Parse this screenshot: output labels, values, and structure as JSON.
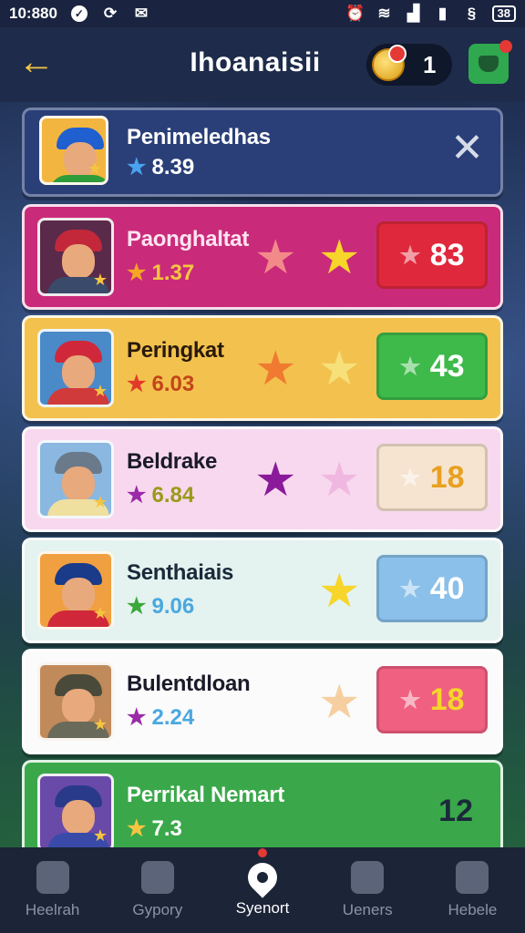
{
  "status_bar": {
    "time": "10:880",
    "battery": "38"
  },
  "header": {
    "title": "Ihoanaisii",
    "coin_count": "1"
  },
  "rows": [
    {
      "name": "Penimeledhas",
      "rating": "8.39",
      "bg": "#2a3f78",
      "rating_star_color": "#4aa3f0",
      "text_color": "#ffffff",
      "rating_color": "#ffffff",
      "has_close": true,
      "star_a_color": "",
      "star_b_color": "",
      "score": "",
      "score_bg": "",
      "score_color": "",
      "hat_color": "#1f5fd0",
      "body_color": "#2f9c3a",
      "avatar_bg": "#f2b640"
    },
    {
      "name": "Paonghaltat",
      "rating": "1.37",
      "bg": "#c92b7a",
      "rating_star_color": "#f5a623",
      "text_color": "#ffe3f0",
      "rating_color": "#f5c542",
      "has_close": false,
      "star_a_color": "#f28a8a",
      "star_b_color": "#f7d52a",
      "score": "83",
      "score_bg": "#e0283c",
      "score_color": "#ffffff",
      "hat_color": "#c2283a",
      "body_color": "#3a4a6a",
      "avatar_bg": "#5a2a4a"
    },
    {
      "name": "Peringkat",
      "rating": "6.03",
      "bg": "#f3c24e",
      "rating_star_color": "#e23a2a",
      "text_color": "#2a1a0a",
      "rating_color": "#c2461a",
      "has_close": false,
      "star_a_color": "#f07a30",
      "star_b_color": "#f7e07a",
      "score": "43",
      "score_bg": "#3dba4a",
      "score_color": "#ffffff",
      "hat_color": "#d0283a",
      "body_color": "#d03a3a",
      "avatar_bg": "#4a8ac8"
    },
    {
      "name": "Beldrake",
      "rating": "6.84",
      "bg": "#f8d8ee",
      "rating_star_color": "#9a2aa8",
      "text_color": "#1a1a2a",
      "rating_color": "#9a9a1a",
      "has_close": false,
      "star_a_color": "#8a1a9a",
      "star_b_color": "#f0b8e0",
      "score": "18",
      "score_bg": "#f6e4d0",
      "score_color": "#e8a020",
      "hat_color": "#6a7a8a",
      "body_color": "#f0e0a0",
      "avatar_bg": "#8ab8e0"
    },
    {
      "name": "Senthaiais",
      "rating": "9.06",
      "bg": "#e4f2f0",
      "rating_star_color": "#3aa83a",
      "text_color": "#1a2a3a",
      "rating_color": "#4aa8e0",
      "has_close": false,
      "star_a_color": "",
      "star_b_color": "#f7d52a",
      "score": "40",
      "score_bg": "#8ac0ea",
      "score_color": "#ffffff",
      "hat_color": "#1a3a8a",
      "body_color": "#d0283a",
      "avatar_bg": "#f0a040"
    },
    {
      "name": "Bulentdloan",
      "rating": "2.24",
      "bg": "#fbfbfb",
      "rating_star_color": "#9a2aa8",
      "text_color": "#1a1a2a",
      "rating_color": "#4aa8e0",
      "has_close": false,
      "star_a_color": "",
      "star_b_color": "#f6cfa0",
      "score": "18",
      "score_bg": "#f06080",
      "score_color": "#f7d52a",
      "hat_color": "#4a4a3a",
      "body_color": "#6a6a5a",
      "avatar_bg": "#c08a5a"
    },
    {
      "name": "Perrikal Nemart",
      "rating": "7.3",
      "bg": "#3aa84a",
      "rating_star_color": "#f5c542",
      "text_color": "#ffffff",
      "rating_color": "#ffffff",
      "has_close": false,
      "star_a_color": "",
      "star_b_color": "",
      "score": "12",
      "score_bg": "",
      "score_color": "#1a2a3a",
      "hat_color": "#2a3a8a",
      "body_color": "#3a4aa8",
      "avatar_bg": "#6a4aa8"
    }
  ],
  "nav": [
    {
      "label": "Heelrah",
      "active": false
    },
    {
      "label": "Gypory",
      "active": false
    },
    {
      "label": "Syenort",
      "active": true
    },
    {
      "label": "Ueners",
      "active": false
    },
    {
      "label": "Hebele",
      "active": false
    }
  ]
}
